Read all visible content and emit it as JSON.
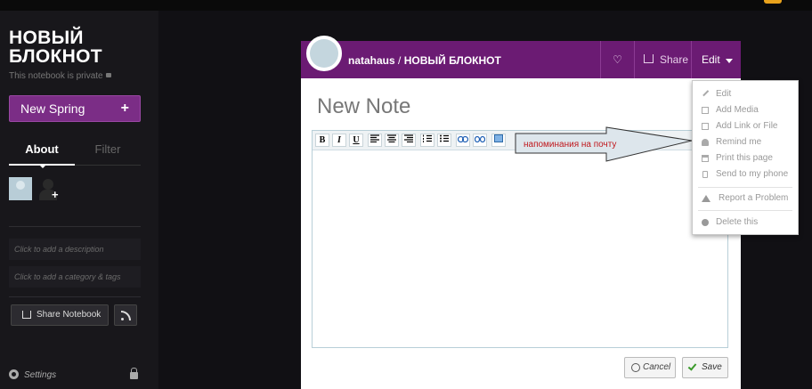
{
  "sidebar": {
    "notebook_title": "НОВЫЙ БЛОКНОТ",
    "private_text": "This notebook is private",
    "new_button": "New Spring",
    "new_button_icon": "plus-icon",
    "tabs": [
      {
        "label": "About",
        "active": true
      },
      {
        "label": "Filter",
        "active": false
      }
    ],
    "description_placeholder": "Click to add a description",
    "category_placeholder": "Click to add a category & tags",
    "share_button": "Share Notebook",
    "settings_label": "Settings"
  },
  "note": {
    "owner": "natahaus",
    "separator": "/",
    "notebook": "НОВЫЙ БЛОКНОТ",
    "share_label": "Share",
    "edit_label": "Edit",
    "title": "New Note",
    "cancel_label": "Cancel",
    "save_label": "Save",
    "toolbar": [
      "bold",
      "italic",
      "underline",
      "align-left",
      "align-center",
      "align-right",
      "ordered-list",
      "unordered-list",
      "link",
      "unlink",
      "image"
    ]
  },
  "toolbar_glyphs": {
    "bold": "B",
    "italic": "I",
    "underline": "U"
  },
  "annotation": "напоминания на почту",
  "edit_menu": [
    {
      "label": "Edit",
      "icon": "pencil-icon"
    },
    {
      "label": "Add Media",
      "icon": "media-icon"
    },
    {
      "label": "Add Link or File",
      "icon": "file-icon"
    },
    {
      "label": "Remind me",
      "icon": "bell-icon"
    },
    {
      "label": "Print this page",
      "icon": "print-icon"
    },
    {
      "label": "Send to my phone",
      "icon": "phone-icon"
    },
    {
      "label": "Report a Problem",
      "icon": "warning-icon"
    },
    {
      "label": "Delete this",
      "icon": "delete-icon"
    }
  ],
  "colors": {
    "brand_purple": "#6b1b73",
    "button_purple": "#7b2d86",
    "annotation_red": "#c0171c",
    "save_green": "#3a9a2a"
  }
}
